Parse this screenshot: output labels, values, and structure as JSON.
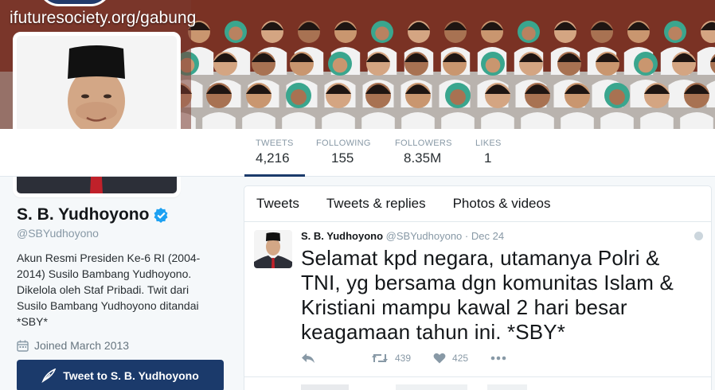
{
  "banner": {
    "url_text": "ifuturesociety.org/gabung"
  },
  "stats": [
    {
      "label": "TWEETS",
      "value": "4,216"
    },
    {
      "label": "FOLLOWING",
      "value": "155"
    },
    {
      "label": "FOLLOWERS",
      "value": "8.35M"
    },
    {
      "label": "LIKES",
      "value": "1"
    }
  ],
  "profile": {
    "name": "S. B. Yudhoyono",
    "handle": "@SBYudhoyono",
    "bio": "Akun Resmi Presiden Ke-6 RI (2004-2014) Susilo Bambang Yudhoyono. Dikelola oleh Staf Pribadi. Twit dari Susilo Bambang Yudhoyono ditandai *SBY*",
    "joined": "Joined March 2013",
    "tweet_to_label": "Tweet to S. B. Yudhoyono"
  },
  "timeline": {
    "tabs": [
      "Tweets",
      "Tweets & replies",
      "Photos & videos"
    ],
    "tweet": {
      "name": "S. B. Yudhoyono",
      "handle": "@SBYudhoyono",
      "separator": "·",
      "date": "Dec 24",
      "text": "Selamat kpd negara, utamanya Polri & TNI, yg bersama dgn komunitas Islam & Kristiani mampu kawal 2 hari besar keagamaan tahun ini. *SBY*",
      "retweets": "439",
      "likes": "425"
    }
  },
  "colors": {
    "accent": "#1b3a6b",
    "verified": "#1da1f2",
    "muted": "#8899a6"
  }
}
